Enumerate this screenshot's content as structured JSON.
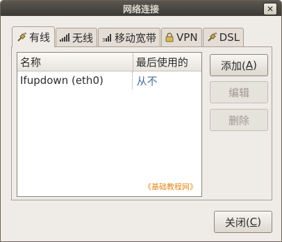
{
  "window": {
    "title": "网络连接"
  },
  "tabs": [
    {
      "label": "有线",
      "icon": "wired-plug-icon",
      "active": true
    },
    {
      "label": "无线",
      "icon": "wireless-signal-icon",
      "active": false
    },
    {
      "label": "移动宽带",
      "icon": "mobile-broadband-signal-icon",
      "active": false
    },
    {
      "label": "VPN",
      "icon": "lock-icon",
      "active": false
    },
    {
      "label": "DSL",
      "icon": "dsl-plug-icon",
      "active": false
    }
  ],
  "table": {
    "columns": [
      "名称",
      "最后使用的"
    ],
    "rows": [
      {
        "name": "Ifupdown (eth0)",
        "last_used": "从不"
      }
    ]
  },
  "buttons": {
    "add": {
      "text": "添加(",
      "mnemonic": "A",
      "suffix": ")"
    },
    "edit": "编辑",
    "delete": "删除",
    "close": {
      "text": "关闭(",
      "mnemonic": "C",
      "suffix": ")"
    }
  },
  "watermark": "《基础教程网》",
  "colors": {
    "titlebar": "#3c3a36",
    "watermark": "#e1891d",
    "accent_text": "#4a6f96"
  }
}
